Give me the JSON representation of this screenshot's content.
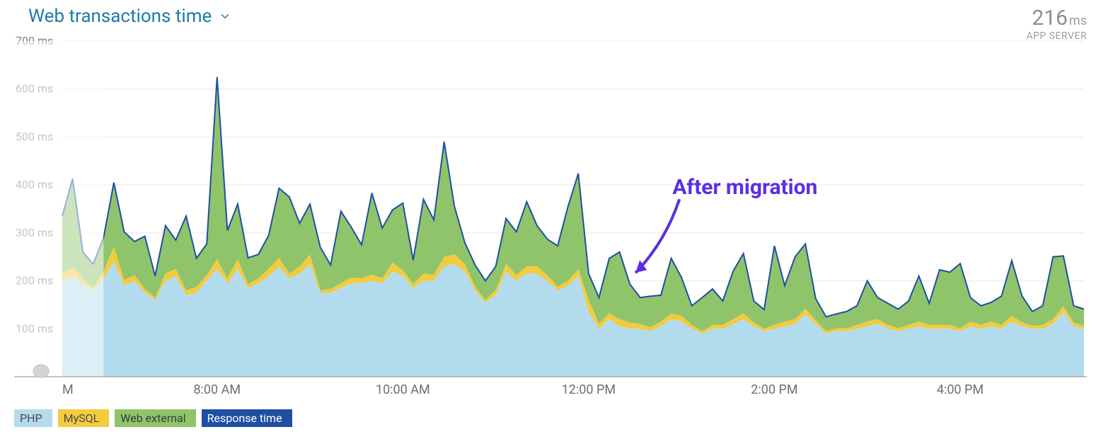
{
  "header": {
    "title": "Web transactions time",
    "metric_value": "216",
    "metric_unit": "ms",
    "metric_sub": "APP SERVER"
  },
  "legend": {
    "php": "PHP",
    "mysql": "MySQL",
    "ext": "Web external",
    "resp": "Response time"
  },
  "annotation": {
    "text": "After migration",
    "target_index": 55
  },
  "chart_data": {
    "type": "area",
    "title": "Web transactions time",
    "ylabel": "ms",
    "xlabel": "",
    "ylim": [
      0,
      700
    ],
    "y_ticks": [
      100,
      200,
      300,
      400,
      500,
      600,
      700
    ],
    "x_tick_labels": [
      "M",
      "8:00 AM",
      "10:00 AM",
      "12:00 PM",
      "2:00 PM",
      "4:00 PM"
    ],
    "x_tick_positions": [
      0,
      15,
      33,
      51,
      69,
      87
    ],
    "series": [
      {
        "name": "PHP",
        "values": [
          200,
          210,
          195,
          180,
          205,
          240,
          190,
          200,
          175,
          160,
          200,
          210,
          170,
          175,
          200,
          225,
          195,
          225,
          185,
          195,
          210,
          230,
          205,
          215,
          235,
          175,
          175,
          185,
          195,
          195,
          200,
          195,
          220,
          210,
          185,
          200,
          200,
          230,
          235,
          220,
          180,
          155,
          170,
          220,
          200,
          215,
          215,
          200,
          180,
          190,
          210,
          135,
          100,
          120,
          105,
          100,
          100,
          95,
          105,
          120,
          115,
          100,
          90,
          100,
          100,
          110,
          120,
          105,
          95,
          100,
          105,
          110,
          130,
          110,
          90,
          95,
          95,
          100,
          105,
          110,
          100,
          95,
          100,
          105,
          100,
          100,
          100,
          95,
          105,
          100,
          105,
          100,
          115,
          105,
          100,
          100,
          110,
          135,
          105,
          100
        ]
      },
      {
        "name": "MySQL",
        "values": [
          15,
          18,
          10,
          5,
          15,
          30,
          12,
          12,
          8,
          5,
          15,
          15,
          10,
          12,
          12,
          20,
          10,
          20,
          8,
          10,
          15,
          18,
          10,
          15,
          20,
          5,
          8,
          10,
          12,
          10,
          13,
          10,
          18,
          12,
          8,
          15,
          12,
          20,
          20,
          15,
          8,
          5,
          10,
          15,
          12,
          15,
          15,
          12,
          8,
          10,
          14,
          25,
          10,
          12,
          15,
          13,
          10,
          8,
          10,
          12,
          12,
          8,
          5,
          8,
          8,
          10,
          12,
          8,
          5,
          8,
          10,
          10,
          12,
          8,
          5,
          6,
          6,
          8,
          10,
          10,
          8,
          6,
          8,
          10,
          8,
          8,
          8,
          6,
          10,
          8,
          10,
          8,
          12,
          8,
          6,
          8,
          10,
          12,
          8,
          6
        ]
      },
      {
        "name": "Web external",
        "values": [
          120,
          185,
          55,
          50,
          70,
          135,
          100,
          70,
          110,
          45,
          100,
          60,
          155,
          60,
          65,
          380,
          100,
          115,
          55,
          50,
          70,
          145,
          160,
          90,
          105,
          90,
          50,
          150,
          105,
          70,
          170,
          105,
          110,
          140,
          50,
          155,
          115,
          240,
          100,
          45,
          45,
          40,
          50,
          95,
          90,
          135,
          85,
          75,
          85,
          155,
          200,
          55,
          55,
          115,
          140,
          80,
          55,
          65,
          55,
          115,
          80,
          40,
          70,
          75,
          50,
          100,
          125,
          45,
          40,
          165,
          75,
          130,
          135,
          45,
          30,
          30,
          35,
          40,
          85,
          45,
          45,
          40,
          50,
          95,
          45,
          115,
          110,
          135,
          50,
          40,
          40,
          60,
          115,
          55,
          30,
          40,
          130,
          105,
          35,
          35
        ]
      }
    ],
    "response_time": [
      335,
      413,
      260,
      235,
      290,
      405,
      302,
      282,
      293,
      210,
      315,
      285,
      335,
      247,
      277,
      625,
      305,
      360,
      248,
      255,
      295,
      393,
      375,
      320,
      360,
      270,
      233,
      345,
      312,
      275,
      383,
      310,
      348,
      362,
      243,
      370,
      327,
      490,
      355,
      280,
      233,
      200,
      230,
      330,
      302,
      365,
      315,
      287,
      273,
      355,
      424,
      215,
      165,
      247,
      260,
      193,
      165,
      168,
      170,
      247,
      207,
      148,
      165,
      183,
      158,
      220,
      257,
      158,
      140,
      273,
      190,
      250,
      277,
      163,
      125,
      131,
      136,
      148,
      200,
      165,
      153,
      141,
      158,
      210,
      153,
      223,
      218,
      236,
      165,
      148,
      155,
      168,
      242,
      168,
      136,
      148,
      250,
      252,
      148,
      141
    ]
  }
}
